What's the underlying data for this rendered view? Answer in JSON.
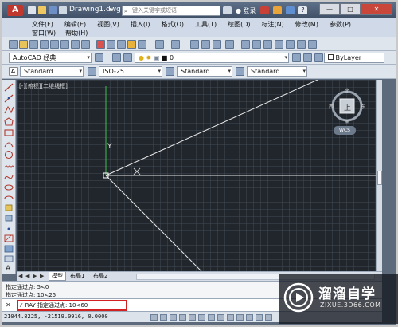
{
  "title_bar": {
    "logo": "A",
    "document_title": "Drawing1.dwg",
    "search_placeholder": "键入关键字或短语",
    "login_label": "登录",
    "help_label": "?",
    "minimize": "—",
    "maximize": "□",
    "close": "✕"
  },
  "menu": {
    "row1": [
      "文件(F)",
      "编辑(E)",
      "视图(V)",
      "插入(I)",
      "格式(O)",
      "工具(T)",
      "绘图(D)",
      "标注(N)",
      "修改(M)",
      "参数(P)"
    ],
    "row2": [
      "窗口(W)",
      "帮助(H)"
    ]
  },
  "toolbars": {
    "workspace": "AutoCAD 经典",
    "layer_name": "0",
    "color_combo": "ByLayer",
    "text_style": "Standard",
    "dim_style": "ISO-25",
    "table_style": "Standard",
    "mleader_style": "Standard"
  },
  "viewport": {
    "label": "[-][俯视][二维线框]",
    "viewcube_face": "上",
    "compass_n": "北",
    "compass_s": "南",
    "compass_e": "东",
    "compass_w": "西",
    "wcs_label": "WCS",
    "y_axis_label": "Y"
  },
  "layout_tabs": {
    "model": "模型",
    "layout1": "布局1",
    "layout2": "布局2"
  },
  "command": {
    "history": [
      "指定通过点: 5<0",
      "指定通过点: 10<25"
    ],
    "prompt": "RAY 指定通过点:  10<60"
  },
  "status": {
    "coordinates": "21044.8225, -21519.0916, 0.0000"
  },
  "watermark": {
    "title": "溜溜自学",
    "url": "ZIXUE.3D66.COM"
  },
  "colors": {
    "canvas_bg": "#21262d",
    "ray_lines": "#e8e8e8",
    "y_axis": "#3fbf4a",
    "highlight_box": "#d32020"
  }
}
